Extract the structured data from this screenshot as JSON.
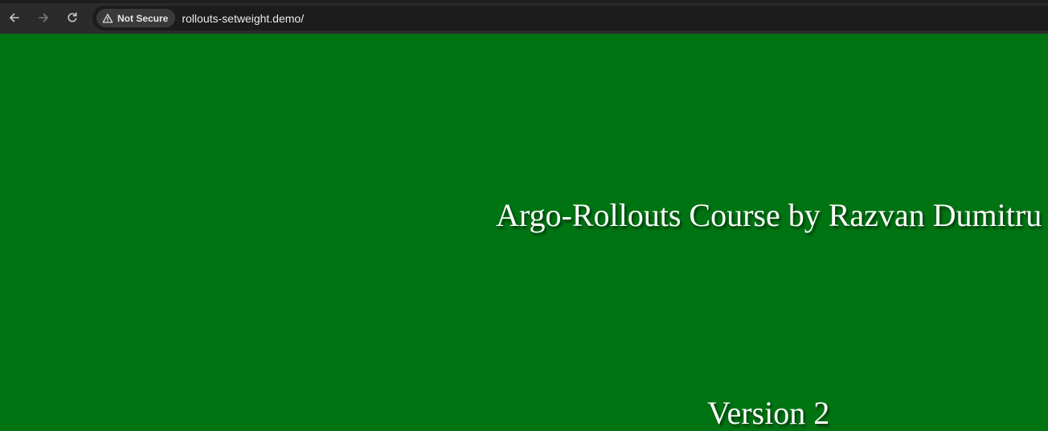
{
  "browser": {
    "nav": {
      "back_icon": "arrow-left-icon",
      "forward_icon": "arrow-right-icon",
      "reload_icon": "reload-icon"
    },
    "security_chip": {
      "icon": "warning-triangle-icon",
      "label": "Not Secure"
    },
    "url": "rollouts-setweight.demo/"
  },
  "page": {
    "background_color": "#007413",
    "heading": "Argo-Rollouts Course by Razvan Dumitru",
    "version": "Version 2"
  }
}
